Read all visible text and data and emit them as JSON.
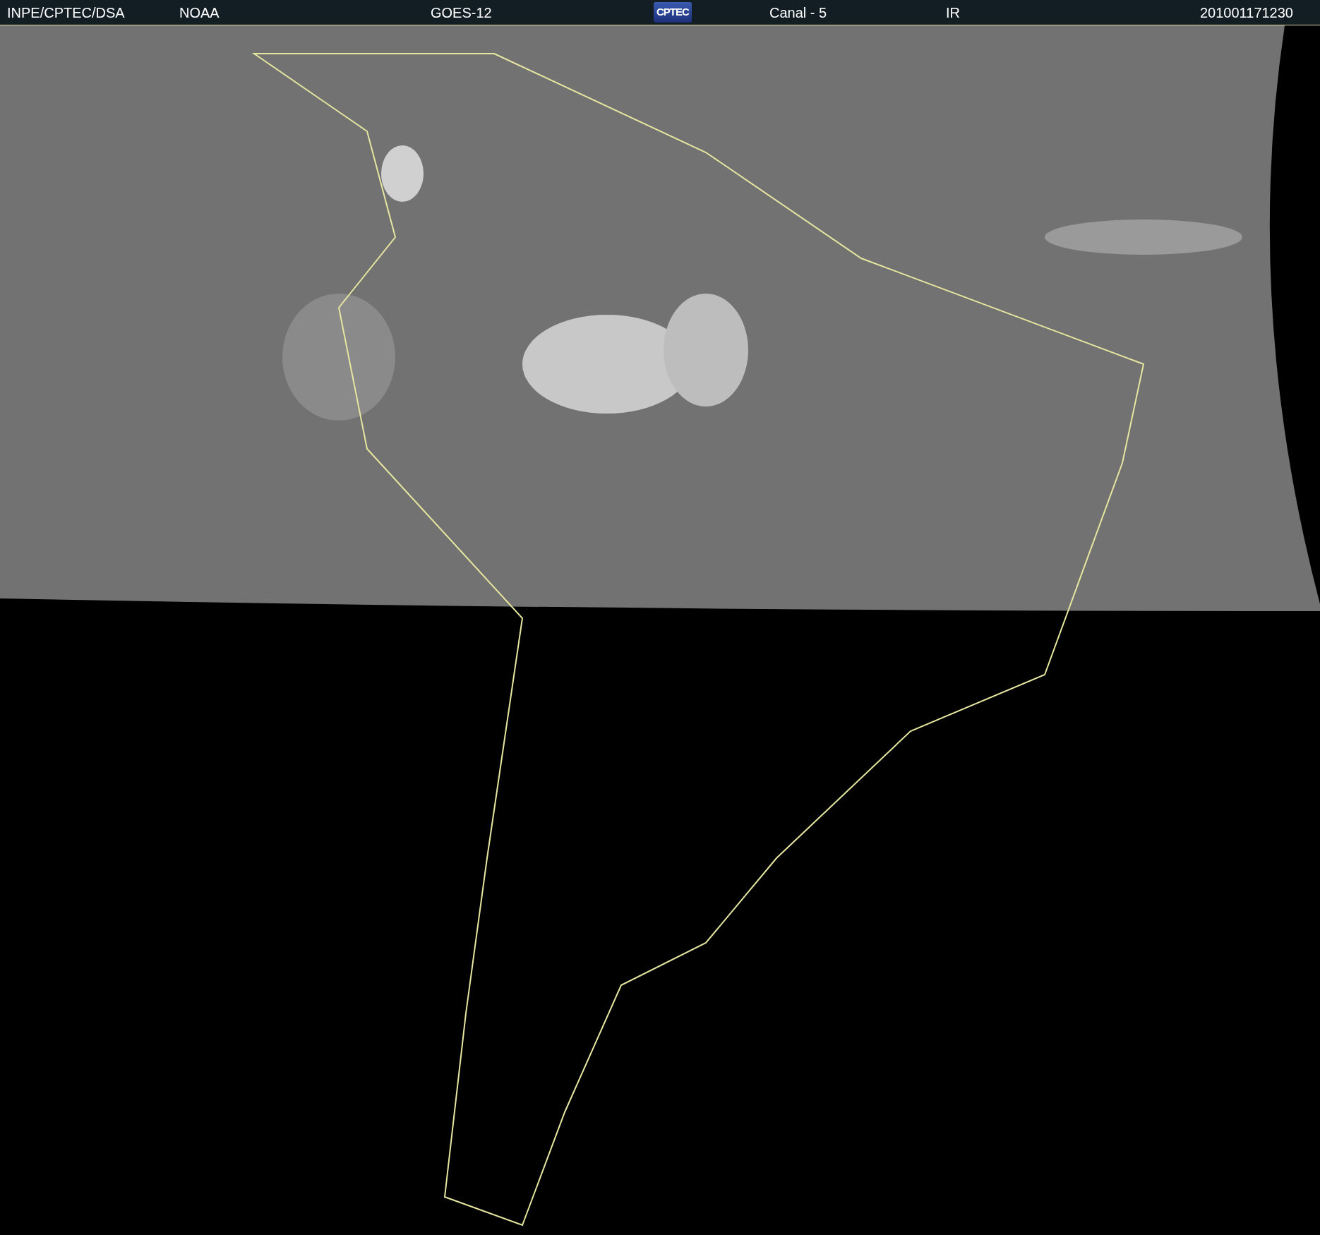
{
  "header": {
    "items": [
      {
        "kind": "text",
        "text": "INPE/CPTEC/DSA"
      },
      {
        "kind": "text",
        "text": "NOAA"
      },
      {
        "kind": "text",
        "text": "GOES-12"
      },
      {
        "kind": "logo",
        "text": "CPTEC"
      },
      {
        "kind": "text",
        "text": "Canal - 5"
      },
      {
        "kind": "text",
        "text": "IR"
      },
      {
        "kind": "text",
        "text": "201001171230"
      }
    ]
  }
}
